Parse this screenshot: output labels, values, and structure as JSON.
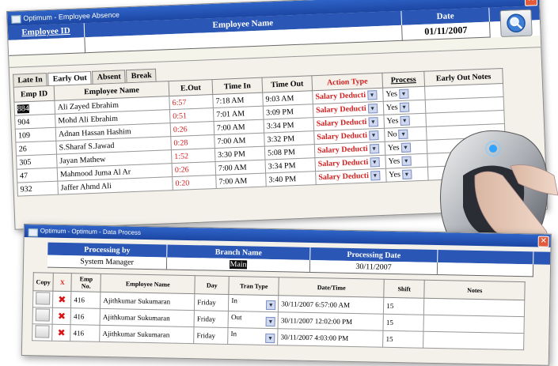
{
  "window1": {
    "title": "Optimum - Employee Absence",
    "header": {
      "employee_id_label": "Employee ID",
      "employee_name_label": "Employee Name",
      "date_label": "Date"
    },
    "date_value": "01/11/2007",
    "tabs": [
      "Late In",
      "Early Out",
      "Absent",
      "Break"
    ],
    "active_tab": "Early Out",
    "columns": [
      "Emp ID",
      "Employee Name",
      "E.Out",
      "Time In",
      "Time Out",
      "Action Type",
      "Process",
      "Early Out Notes"
    ],
    "rows": [
      {
        "id": "884",
        "name": "Ali Zayed Ebrahim",
        "eout": "6:57",
        "time_in": "7:18 AM",
        "time_out": "9:03 AM",
        "action": "Salary Deducti",
        "process": "Yes"
      },
      {
        "id": "904",
        "name": "Mohd Ali Ebrahim",
        "eout": "0:51",
        "time_in": "7:01 AM",
        "time_out": "3:09 PM",
        "action": "Salary Deducti",
        "process": "Yes"
      },
      {
        "id": "109",
        "name": "Adnan Hassan Hashim",
        "eout": "0:26",
        "time_in": "7:00 AM",
        "time_out": "3:34 PM",
        "action": "Salary Deducti",
        "process": "Yes"
      },
      {
        "id": "26",
        "name": "S.Sharaf S.Jawad",
        "eout": "0:28",
        "time_in": "7:00 AM",
        "time_out": "3:32 PM",
        "action": "Salary Deducti",
        "process": "No"
      },
      {
        "id": "305",
        "name": "Jayan Mathew",
        "eout": "1:52",
        "time_in": "3:30 PM",
        "time_out": "5:08 PM",
        "action": "Salary Deducti",
        "process": "Yes"
      },
      {
        "id": "47",
        "name": "Mahmood Juma Al Ar",
        "eout": "0:26",
        "time_in": "7:00 AM",
        "time_out": "3:34 PM",
        "action": "Salary Deducti",
        "process": "Yes"
      },
      {
        "id": "932",
        "name": "Jaffer Ahmd Ali",
        "eout": "0:20",
        "time_in": "7:00 AM",
        "time_out": "3:40 PM",
        "action": "Salary Deducti",
        "process": "Yes"
      }
    ]
  },
  "window2": {
    "title": "Optimum - Optimum - Data Process",
    "header": {
      "processing_by_label": "Processing by",
      "branch_name_label": "Branch Name",
      "processing_date_label": "Processing Date"
    },
    "values": {
      "processing_by": "System Manager",
      "branch_name": "Main",
      "processing_date": "30/11/2007"
    },
    "columns": [
      "Copy",
      "X",
      "Emp No.",
      "Employee Name",
      "Day",
      "Tran Type",
      "Date/Time",
      "Shift",
      "Notes"
    ],
    "rows": [
      {
        "emp_no": "416",
        "name": "Ajithkumar Sukumaran",
        "day": "Friday",
        "tran": "In",
        "datetime": "30/11/2007 6:57:00 AM",
        "shift": "15"
      },
      {
        "emp_no": "416",
        "name": "Ajithkumar Sukumaran",
        "day": "Friday",
        "tran": "Out",
        "datetime": "30/11/2007 12:02:00 PM",
        "shift": "15"
      },
      {
        "emp_no": "416",
        "name": "Ajithkumar Sukumaran",
        "day": "Friday",
        "tran": "In",
        "datetime": "30/11/2007 4:03:00 PM",
        "shift": "15"
      }
    ]
  },
  "colors": {
    "header_blue": "#2a56b5",
    "action_red": "#d32020",
    "title_blue": "#1c46a3"
  },
  "icons": [
    "close-icon",
    "search-icon",
    "dropdown-arrow-icon",
    "delete-icon",
    "copy-icon",
    "fingerprint-scanner-icon"
  ]
}
